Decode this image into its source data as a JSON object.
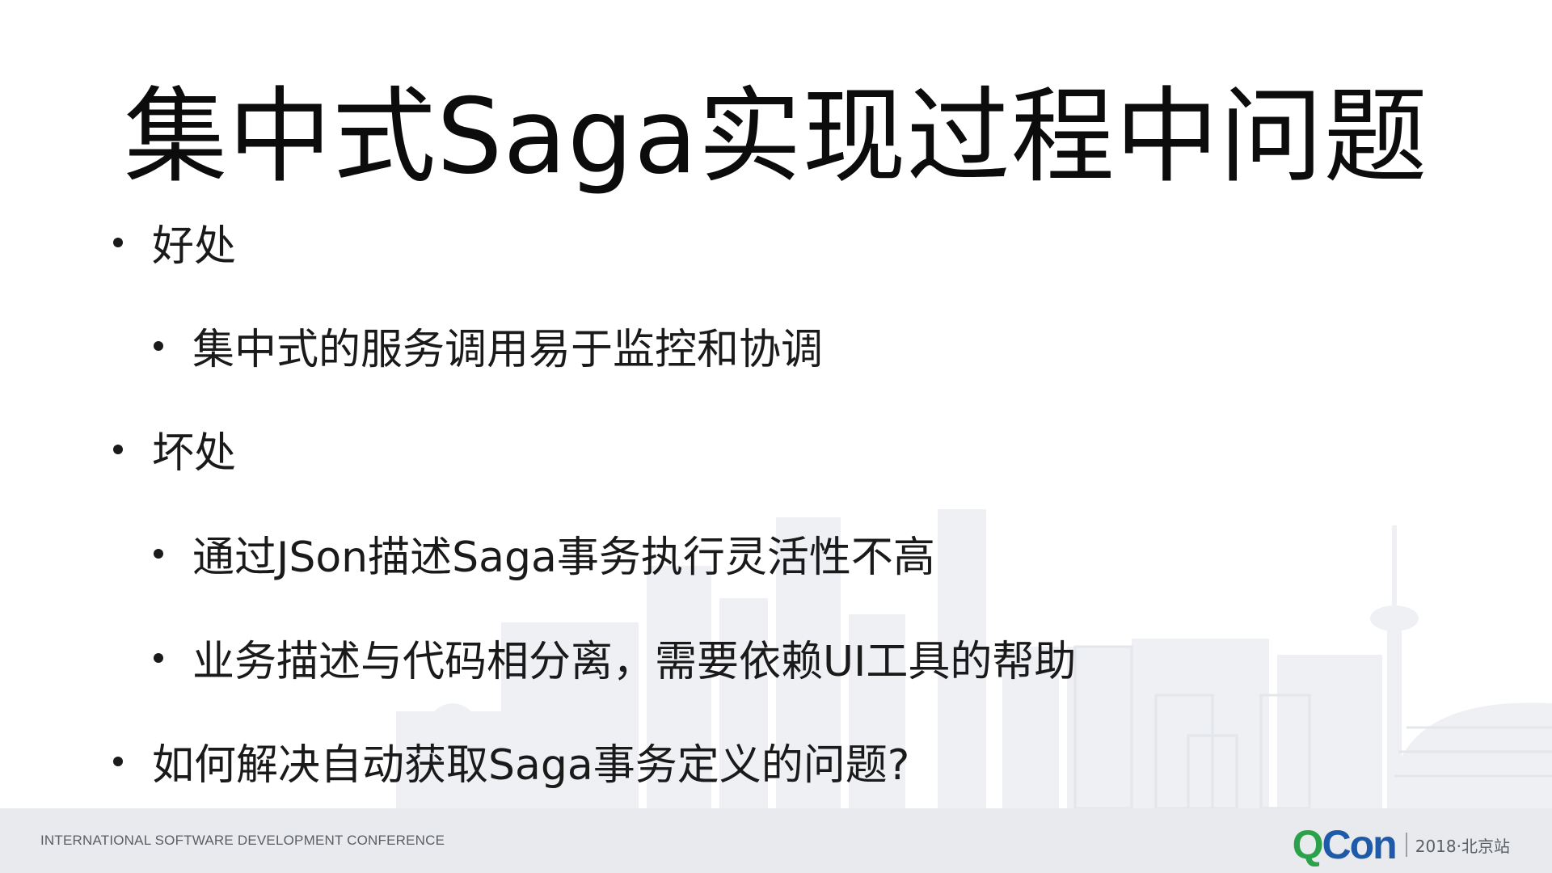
{
  "slide": {
    "title": "集中式Saga实现过程中问题",
    "bullets": [
      {
        "level": 1,
        "text": "好处"
      },
      {
        "level": 2,
        "text": "集中式的服务调用易于监控和协调"
      },
      {
        "level": 1,
        "text": "坏处"
      },
      {
        "level": 2,
        "text": "通过JSon描述Saga事务执行灵活性不高"
      },
      {
        "level": 2,
        "text": "业务描述与代码相分离，需要依赖UI工具的帮助"
      },
      {
        "level": 1,
        "text": "如何解决自动获取Saga事务定义的问题?"
      }
    ]
  },
  "footer": {
    "conference": "INTERNATIONAL SOFTWARE DEVELOPMENT CONFERENCE",
    "brand_q": "Q",
    "brand_con": "Con",
    "edition": "2018·北京站"
  },
  "colors": {
    "brand_green": "#2ba24a",
    "brand_blue": "#1f5aa8",
    "footer_bg": "#e8eaed",
    "skyline": "#eef0f3"
  },
  "icons": {
    "bullet": "bullet-dot-icon",
    "background": "beijing-skyline-graphic"
  }
}
